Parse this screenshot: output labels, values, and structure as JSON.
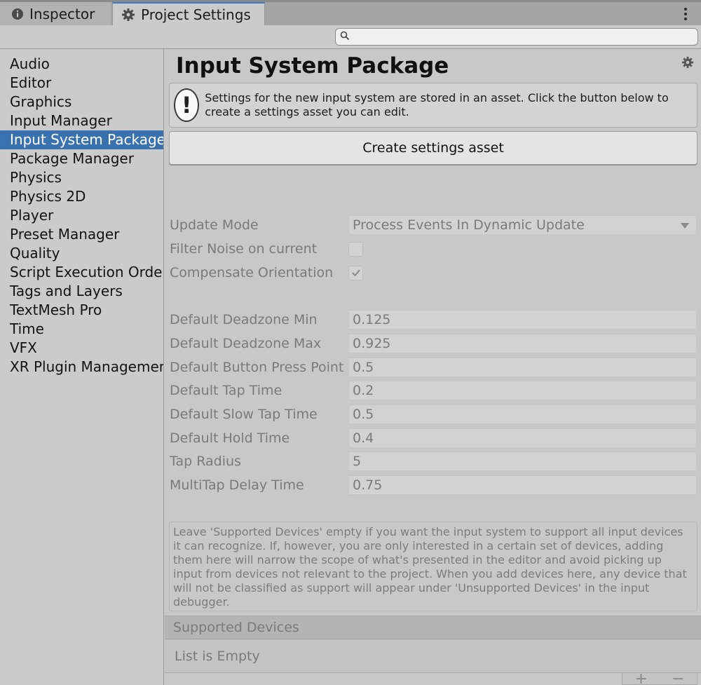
{
  "tabs": {
    "inspector": "Inspector",
    "project_settings": "Project Settings"
  },
  "search": {
    "placeholder": "",
    "value": ""
  },
  "sidebar": {
    "items": [
      {
        "label": "Audio"
      },
      {
        "label": "Editor"
      },
      {
        "label": "Graphics"
      },
      {
        "label": "Input Manager"
      },
      {
        "label": "Input System Package",
        "selected": true
      },
      {
        "label": "Package Manager"
      },
      {
        "label": "Physics"
      },
      {
        "label": "Physics 2D"
      },
      {
        "label": "Player"
      },
      {
        "label": "Preset Manager"
      },
      {
        "label": "Quality"
      },
      {
        "label": "Script Execution Order"
      },
      {
        "label": "Tags and Layers"
      },
      {
        "label": "TextMesh Pro"
      },
      {
        "label": "Time"
      },
      {
        "label": "VFX"
      },
      {
        "label": "XR Plugin Management"
      }
    ]
  },
  "main": {
    "title": "Input System Package",
    "help_text": "Settings for the new input system are stored in an asset. Click the button below to create a settings asset you can edit.",
    "create_button": "Create settings asset",
    "update_mode": {
      "label": "Update Mode",
      "value": "Process Events In Dynamic Update"
    },
    "filter_noise": {
      "label": "Filter Noise on current",
      "checked": false
    },
    "compensate_orientation": {
      "label": "Compensate Orientation",
      "checked": true
    },
    "fields": [
      {
        "label": "Default Deadzone Min",
        "value": "0.125"
      },
      {
        "label": "Default Deadzone Max",
        "value": "0.925"
      },
      {
        "label": "Default Button Press Point",
        "value": "0.5"
      },
      {
        "label": "Default Tap Time",
        "value": "0.2"
      },
      {
        "label": "Default Slow Tap Time",
        "value": "0.5"
      },
      {
        "label": "Default Hold Time",
        "value": "0.4"
      },
      {
        "label": "Tap Radius",
        "value": "5"
      },
      {
        "label": "MultiTap Delay Time",
        "value": "0.75"
      }
    ],
    "supported_info": "Leave 'Supported Devices' empty if you want the input system to support all input devices it can recognize. If, however, you are only interested in a certain set of devices, adding them here will narrow the scope of what's presented in the editor and avoid picking up input from devices not relevant to the project. When you add devices here, any device that will not be classified as support will appear under 'Unsupported Devices' in the input debugger.",
    "supported_devices_header": "Supported Devices",
    "list_empty": "List is Empty",
    "add_label": "+",
    "remove_label": "−"
  },
  "colors": {
    "selection": "#3a72b0",
    "active_tab_accent": "#3a78c8"
  },
  "icons": {
    "inspector_tab": "info-icon",
    "project_tab": "gear-icon",
    "menu": "kebab-menu-icon",
    "search": "search-icon",
    "settings": "gear-icon",
    "help": "warning-icon"
  }
}
